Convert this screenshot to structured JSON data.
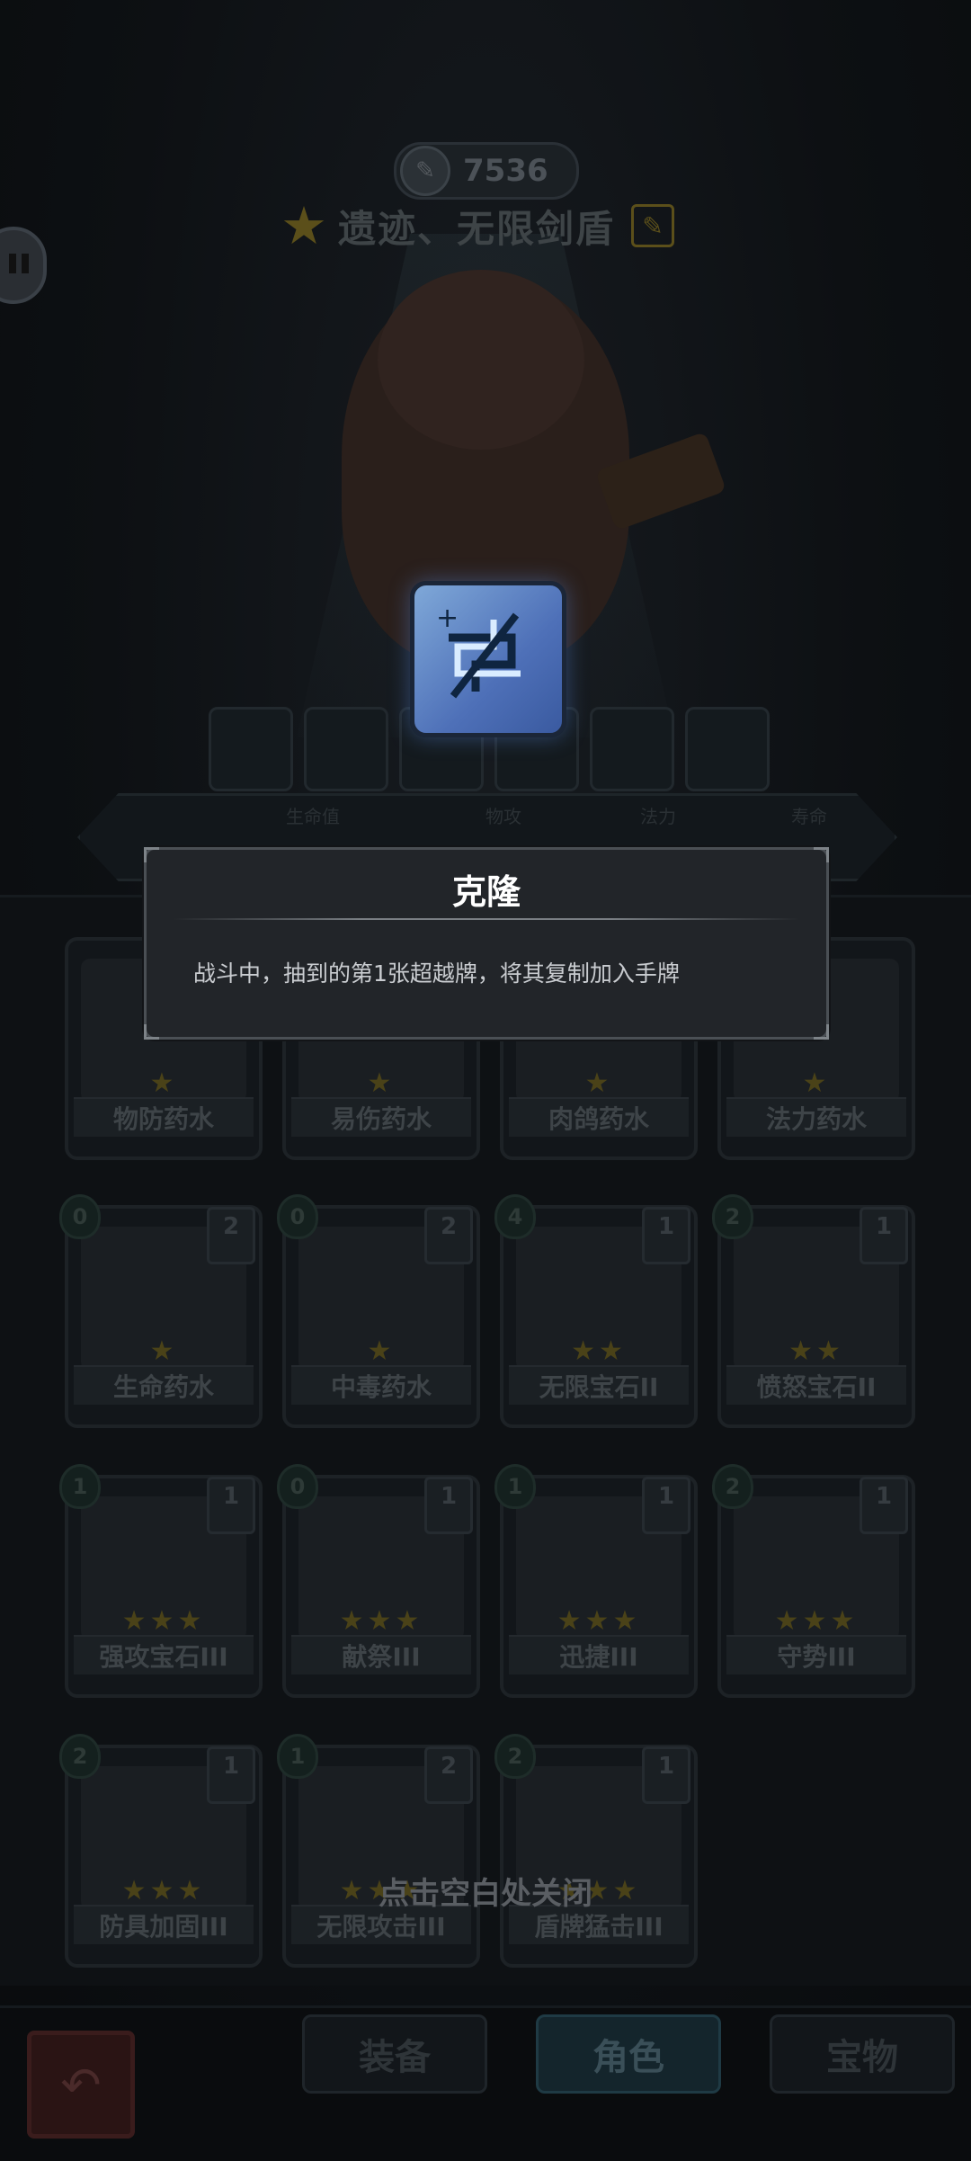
{
  "header": {
    "score": "7536",
    "deck_name": "遗迹、无限剑盾"
  },
  "stats": {
    "labels": [
      "生命值",
      "物攻",
      "法力",
      "寿命"
    ]
  },
  "popup": {
    "title": "克隆",
    "description": "战斗中，抽到的第1张超越牌，将其复制加入手牌"
  },
  "cards": [
    {
      "name": "物防药水",
      "stars": "★"
    },
    {
      "name": "易伤药水",
      "stars": "★"
    },
    {
      "name": "肉鸽药水",
      "stars": "★"
    },
    {
      "name": "法力药水",
      "stars": "★"
    },
    {
      "name": "生命药水",
      "cost": "0",
      "count": "2",
      "stars": "★"
    },
    {
      "name": "中毒药水",
      "cost": "0",
      "count": "2",
      "stars": "★"
    },
    {
      "name": "无限宝石II",
      "cost": "4",
      "count": "1",
      "stars": "★★"
    },
    {
      "name": "愤怒宝石II",
      "cost": "2",
      "count": "1",
      "stars": "★★"
    },
    {
      "name": "强攻宝石III",
      "cost": "1",
      "count": "1",
      "stars": "★★★"
    },
    {
      "name": "献祭III",
      "cost": "0",
      "count": "1",
      "stars": "★★★"
    },
    {
      "name": "迅捷III",
      "cost": "1",
      "count": "1",
      "stars": "★★★"
    },
    {
      "name": "守势III",
      "cost": "2",
      "count": "1",
      "stars": "★★★"
    },
    {
      "name": "防具加固III",
      "cost": "2",
      "count": "1",
      "stars": "★★★"
    },
    {
      "name": "无限攻击III",
      "cost": "1",
      "count": "2",
      "stars": "★★★"
    },
    {
      "name": "盾牌猛击III",
      "cost": "2",
      "count": "1",
      "stars": "★★★"
    }
  ],
  "hint": "点击空白处关闭",
  "nav": {
    "back_icon": "↶",
    "tabs": [
      "装备",
      "角色",
      "宝物"
    ],
    "active_tab": "角色"
  }
}
